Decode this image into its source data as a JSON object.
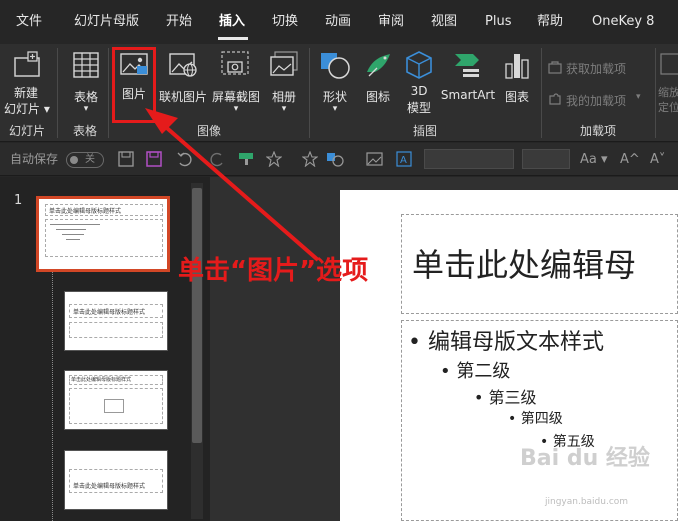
{
  "menu": {
    "items": [
      {
        "label": "文件"
      },
      {
        "label": "幻灯片母版"
      },
      {
        "label": "开始"
      },
      {
        "label": "插入"
      },
      {
        "label": "切换"
      },
      {
        "label": "动画"
      },
      {
        "label": "审阅"
      },
      {
        "label": "视图"
      },
      {
        "label": "Plus"
      },
      {
        "label": "帮助"
      },
      {
        "label": "OneKey 8"
      }
    ],
    "active": "插入"
  },
  "ribbon": {
    "new_slide": {
      "line1": "新建",
      "line2": "幻灯片 ▾"
    },
    "table": {
      "label": "表格",
      "caret": "▾"
    },
    "picture": {
      "label": "图片"
    },
    "online_picture": {
      "label": "联机图片"
    },
    "screenshot": {
      "label": "屏幕截图",
      "caret": "▾"
    },
    "album": {
      "label": "相册",
      "caret": "▾"
    },
    "shapes": {
      "label": "形状",
      "caret": "▾"
    },
    "icons": {
      "label": "图标"
    },
    "model3d": {
      "line1": "3D",
      "line2": "模型",
      "caret": "▾"
    },
    "smartart": {
      "label": "SmartArt"
    },
    "chart": {
      "label": "图表"
    },
    "get_addins": {
      "label": "获取加载项"
    },
    "my_addins": {
      "label": "我的加载项",
      "caret": "▾"
    },
    "zoom_partial": {
      "line1": "缩放",
      "line2": "定位"
    },
    "groups": {
      "slides": "幻灯片",
      "tables": "表格",
      "images": "图像",
      "illustrations": "插图",
      "addins": "加载项"
    }
  },
  "qat": {
    "autosave": "自动保存",
    "autosave_state": "关",
    "font_size_label": "Aa ▾",
    "grow": "A^",
    "shrink": "A˅"
  },
  "thumbnails": {
    "slide_number": "1",
    "master_title": "单击此处编辑母版标题样式",
    "layout_title": "单击此处编辑母版标题样式"
  },
  "slide": {
    "title": "单击此处编辑母",
    "levels": [
      "编辑母版文本样式",
      "第二级",
      "第三级",
      "第四级",
      "第五级"
    ]
  },
  "annotation": {
    "text": "单击“图片”选项",
    "color": "#e51b1b"
  },
  "watermark": {
    "text": "Bai du 经验",
    "sub": "jingyan.baidu.com"
  },
  "colors": {
    "accent_red": "#e51b1b",
    "save_purple": "#b14fc5",
    "shape_blue": "#3b8ed8",
    "smartart_green": "#2fa56b"
  }
}
